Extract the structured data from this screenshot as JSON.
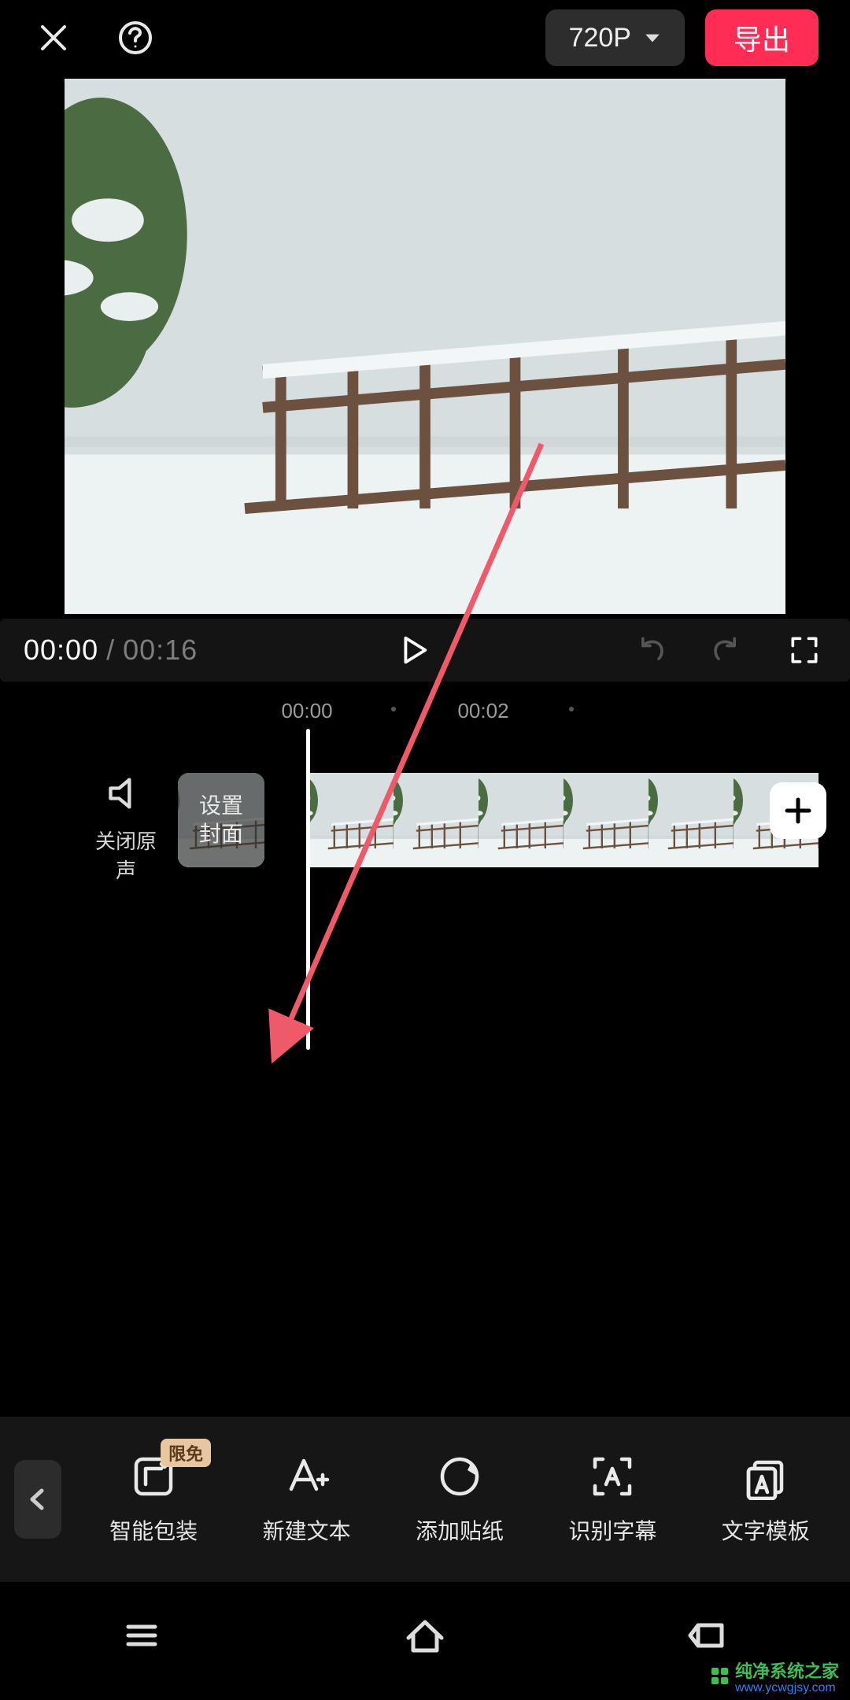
{
  "topbar": {
    "resolution_label": "720P",
    "export_label": "导出"
  },
  "player": {
    "current_time": "00:00",
    "separator": " / ",
    "duration": "00:16"
  },
  "ruler": {
    "marks": [
      "00:00",
      "00:02"
    ]
  },
  "timeline": {
    "mute_label": "关闭原声",
    "cover_label": "设置\n封面"
  },
  "toolbar": {
    "items": [
      {
        "id": "smart-package",
        "label": "智能包装",
        "badge": "限免",
        "icon": "tpulse"
      },
      {
        "id": "new-text",
        "label": "新建文本",
        "badge": null,
        "icon": "aplus"
      },
      {
        "id": "add-sticker",
        "label": "添加贴纸",
        "badge": null,
        "icon": "moon"
      },
      {
        "id": "auto-caption",
        "label": "识别字幕",
        "badge": null,
        "icon": "focusA"
      },
      {
        "id": "text-template",
        "label": "文字模板",
        "badge": null,
        "icon": "tmplA"
      }
    ]
  },
  "watermark": {
    "line1": "纯净系统之家",
    "line2": "www.ycwgjsy.com"
  },
  "colors": {
    "accent": "#ff2d55",
    "badge_bg": "#e7c7a2",
    "badge_fg": "#5a3a1d"
  }
}
